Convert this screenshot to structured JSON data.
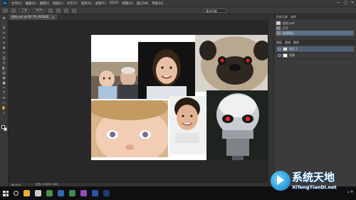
{
  "app": {
    "logo_text": "Ps",
    "menu": [
      "文件(F)",
      "编辑(E)",
      "图像(I)",
      "图层(L)",
      "文字(Y)",
      "选择(S)",
      "滤镜(T)",
      "3D(D)",
      "视图(V)",
      "窗口(W)",
      "帮助(H)"
    ],
    "window_controls": [
      "—",
      "□",
      "✕"
    ]
  },
  "options_bar": {
    "mode_value": "正常",
    "opacity_value": "100%",
    "workspace_value": "基本功能"
  },
  "document": {
    "tab_title": "组合.psd @ 66.7% (RGB/8)",
    "tab_close": "×",
    "status_zoom": "66.67%",
    "status_doc": "文档:1.54M/5.18M"
  },
  "history_panel": {
    "tabs": [
      "历史记录",
      "动作"
    ],
    "items": [
      "组合.psd",
      "打开",
      "新建图层"
    ]
  },
  "layers_panel": {
    "tabs": [
      "图层",
      "通道",
      "路径"
    ],
    "layers": [
      "图层 1",
      "背景"
    ]
  },
  "toolbar": {
    "tools": [
      "move-tool",
      "marquee-tool",
      "lasso-tool",
      "quick-select-tool",
      "crop-tool",
      "eyedropper-tool",
      "healing-tool",
      "brush-tool",
      "clone-stamp-tool",
      "history-brush-tool",
      "eraser-tool",
      "gradient-tool",
      "blur-tool",
      "dodge-tool",
      "pen-tool",
      "type-tool",
      "path-select-tool",
      "shape-tool",
      "hand-tool",
      "zoom-tool"
    ],
    "tool_glyphs": [
      "✥",
      "⬚",
      "ʘ",
      "✎",
      "⌗",
      "✒",
      "✚",
      "✎",
      "⎙",
      "↺",
      "◧",
      "▤",
      "◉",
      "●",
      "✑",
      "T",
      "➤",
      "▭",
      "✋",
      "⌕"
    ],
    "foreground_color": "#000000",
    "background_color": "#ffffff"
  },
  "taskbar": {
    "apps": [
      "file-explorer-icon",
      "settings-icon",
      "chrome-icon",
      "app-icon-1",
      "store-icon",
      "app-icon-2",
      "app-icon-3",
      "photoshop-icon"
    ],
    "app_colors": [
      "#e8b02e",
      "#cccccc",
      "#4a8f4a",
      "#2f6bb3",
      "#3a8a5a",
      "#8f4fb3",
      "#3050b0",
      "#1f3d70"
    ],
    "tray_text": "∧ 中"
  },
  "watermark": {
    "title": "系统天地",
    "url": "XiTongTianDi.net"
  },
  "colors": {
    "accent_selection": "#5d6e86",
    "workspace_bg": "#282828"
  }
}
